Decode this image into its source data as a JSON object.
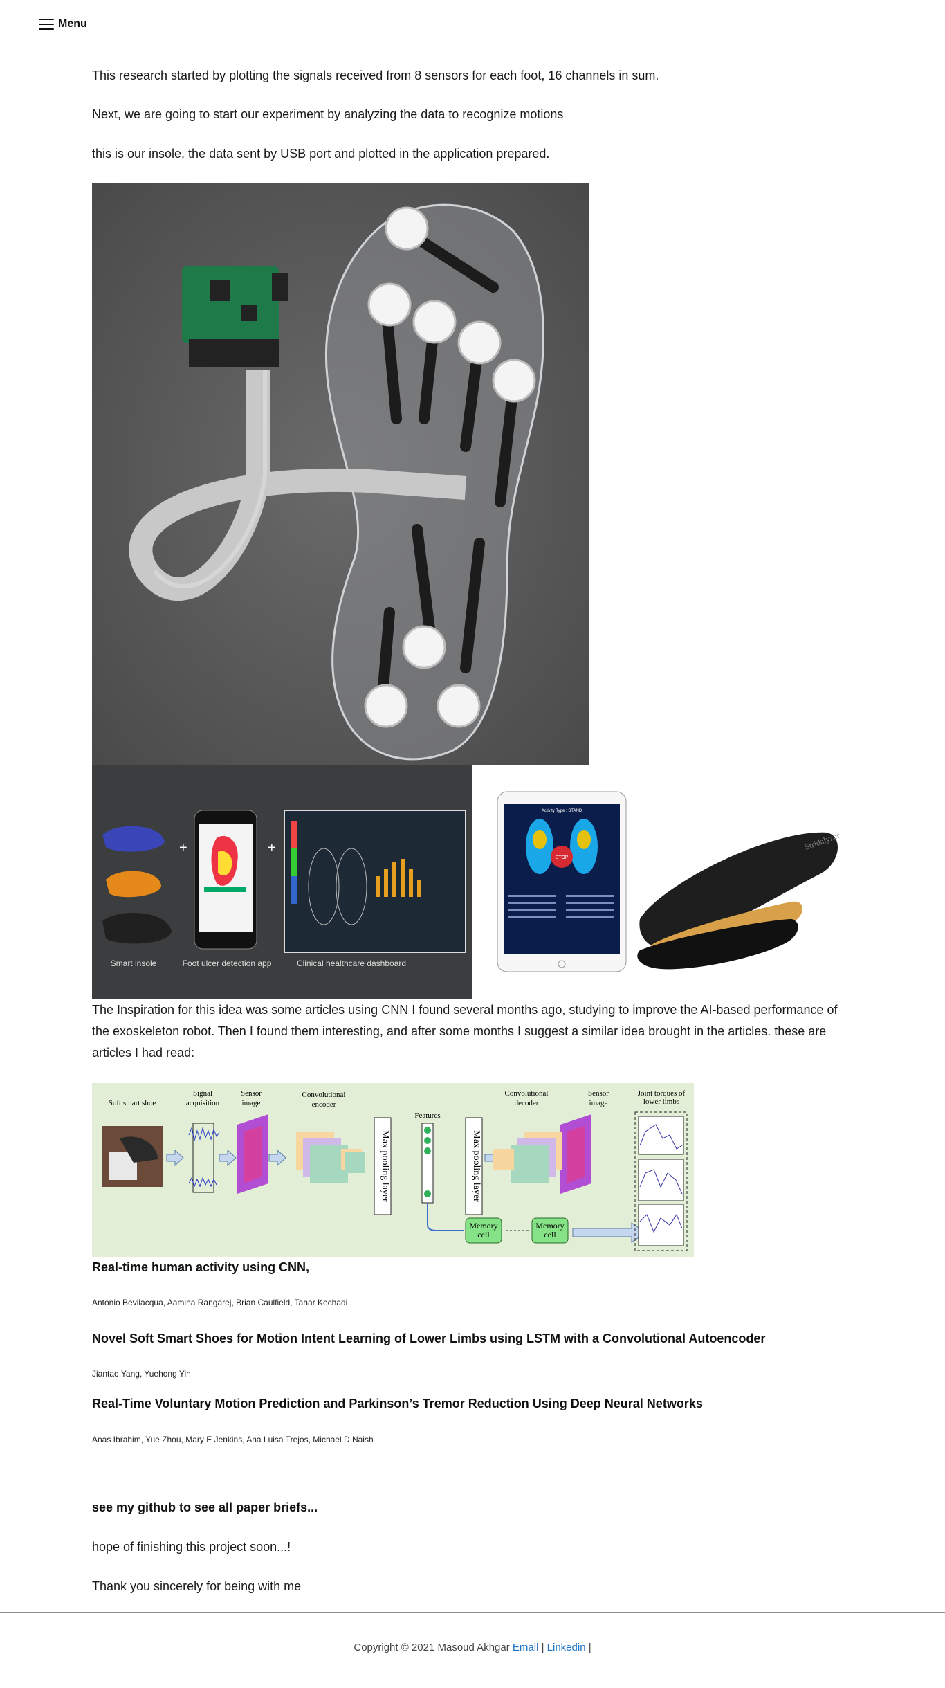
{
  "nav": {
    "menu_label": "Menu"
  },
  "intro": {
    "p1": "This research started by plotting the signals received from 8 sensors for each foot, 16 channels in sum.",
    "p2": "Next, we are going to start our experiment by analyzing the data to recognize motions",
    "p3": "this is our insole, the data sent by USB port and plotted in the application prepared."
  },
  "collage": {
    "captions": [
      "Smart insole",
      "Foot ulcer detection app",
      "Clinical healthcare dashboard"
    ],
    "tablet_title": "Activity Type : STAND",
    "tablet_stop": "STOP",
    "insole_brand": "Stridalyzer"
  },
  "inspiration": "The Inspiration for this idea was some articles using CNN I found several months ago, studying to improve the AI-based performance of the exoskeleton robot. Then I found them interesting, and after some months I suggest a similar idea brought in the articles. these are articles I had read:",
  "diagram": {
    "labels": {
      "soft_shoe": "Soft smart shoe",
      "signal_acq_1": "Signal",
      "signal_acq_2": "acquisition",
      "sensor_img_1": "Sensor",
      "sensor_img_2": "image",
      "conv_enc_1": "Convolutional",
      "conv_enc_2": "encoder",
      "max_pool": "Max pooling layer",
      "features": "Features",
      "conv_dec_1": "Convolutional",
      "conv_dec_2": "decoder",
      "sensor_img2_1": "Sensor",
      "sensor_img2_2": "image",
      "torques_1": "Joint torques of",
      "torques_2": "lower limbs",
      "memory_1": "Memory",
      "memory_2": "cell"
    }
  },
  "references": [
    {
      "title": "Real-time human activity using CNN,",
      "authors": "Antonio Bevilacqua, Aamina Rangarej, Brian Caulfield, Tahar Kechadi"
    },
    {
      "title": "Novel Soft Smart Shoes for Motion Intent Learning of Lower Limbs using LSTM with a Convolutional Autoencoder",
      "authors": "Jiantao Yang, Yuehong Yin"
    },
    {
      "title": "Real-Time Voluntary Motion Prediction and Parkinson’s Tremor Reduction Using Deep Neural Networks",
      "authors": "Anas Ibrahim, Yue Zhou, Mary E Jenkins, Ana Luisa Trejos, Michael D Naish"
    }
  ],
  "outro": {
    "github": "see my github to see all paper briefs...",
    "hope": "hope of finishing this project soon...!",
    "thanks": "Thank you sincerely for being with me"
  },
  "footer": {
    "copyright": "Copyright © 2021 Masoud Akhgar",
    "email": "Email",
    "sep": "|",
    "linkedin": "Linkedin"
  }
}
